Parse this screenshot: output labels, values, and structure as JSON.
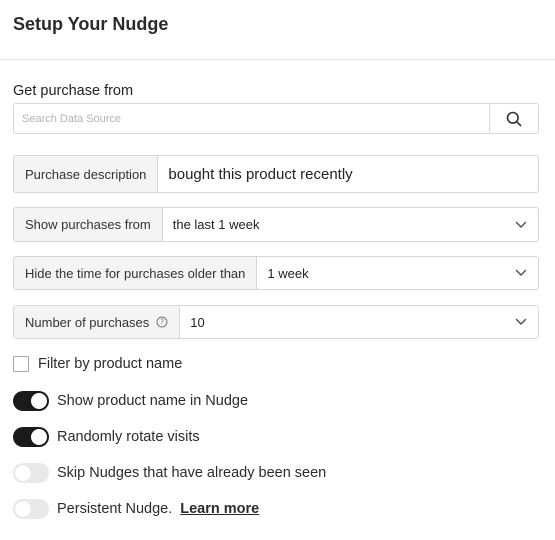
{
  "header": {
    "title": "Setup Your Nudge"
  },
  "source": {
    "label": "Get purchase from",
    "search_placeholder": "Search Data Source",
    "search_icon": "search-icon"
  },
  "purchase_description": {
    "label": "Purchase description",
    "value": "bought this product recently"
  },
  "show_purchases_from": {
    "label": "Show purchases from",
    "value": "the last 1 week"
  },
  "hide_time": {
    "label": "Hide the time for purchases older than",
    "value": "1 week"
  },
  "number_of_purchases": {
    "label": "Number of purchases",
    "value": "10",
    "info_icon": "info-icon"
  },
  "options": {
    "filter_by_product_name": {
      "label": "Filter by product name",
      "checked": false
    },
    "show_product_name": {
      "label": "Show product name in Nudge",
      "on": true
    },
    "randomly_rotate": {
      "label": "Randomly rotate visits",
      "on": true
    },
    "skip_seen": {
      "label": "Skip Nudges that have already been seen",
      "on": false
    },
    "persistent": {
      "label": "Persistent Nudge.",
      "link": "Learn more",
      "on": false
    }
  },
  "colors": {
    "toggle_on": "#1a1a1a",
    "toggle_off": "#e9e9e9",
    "addon_bg": "#f4f4f5",
    "border": "#d6d6d6"
  }
}
